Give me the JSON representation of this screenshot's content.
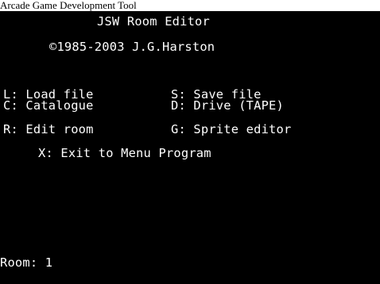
{
  "window": {
    "caption": "Arcade Game Development Tool"
  },
  "screen": {
    "title": "JSW Room Editor",
    "copyright": "©1985-2003 J.G.Harston",
    "menu": [
      {
        "key": "L",
        "label": "L: Load file"
      },
      {
        "key": "S",
        "label": "S: Save file"
      },
      {
        "key": "C",
        "label": "C: Catalogue"
      },
      {
        "key": "D",
        "label": "D: Drive (TAPE)"
      },
      {
        "key": "R",
        "label": "R: Edit room"
      },
      {
        "key": "G",
        "label": "G: Sprite editor"
      },
      {
        "key": "X",
        "label": "X: Exit to Menu Program"
      }
    ],
    "status": "Room: 1"
  },
  "colors": {
    "background": "#000000",
    "text": "#ffffff"
  }
}
